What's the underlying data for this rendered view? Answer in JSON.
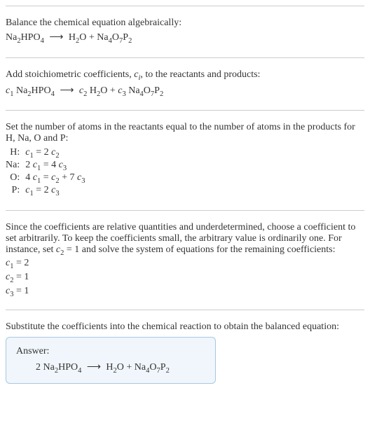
{
  "s1": {
    "title": "Balance the chemical equation algebraically:",
    "eq": "Na<sub>2</sub>HPO<sub>4</sub> <span class='arrow'>⟶</span> H<sub>2</sub>O + Na<sub>4</sub>O<sub>7</sub>P<sub>2</sub>"
  },
  "s2": {
    "title": "Add stoichiometric coefficients, <span class='italic'>c<sub>i</sub></span>, to the reactants and products:",
    "eq": "<span class='italic'>c</span><sub>1</sub> Na<sub>2</sub>HPO<sub>4</sub> <span class='arrow'>⟶</span> <span class='italic'>c</span><sub>2</sub> H<sub>2</sub>O + <span class='italic'>c</span><sub>3</sub> Na<sub>4</sub>O<sub>7</sub>P<sub>2</sub>"
  },
  "s3": {
    "title": "Set the number of atoms in the reactants equal to the number of atoms in the products for H, Na, O and P:",
    "rows": [
      {
        "label": "H:",
        "eq": "<span class='italic'>c</span><sub>1</sub> = 2 <span class='italic'>c</span><sub>2</sub>"
      },
      {
        "label": "Na:",
        "eq": "2 <span class='italic'>c</span><sub>1</sub> = 4 <span class='italic'>c</span><sub>3</sub>"
      },
      {
        "label": "O:",
        "eq": "4 <span class='italic'>c</span><sub>1</sub> = <span class='italic'>c</span><sub>2</sub> + 7 <span class='italic'>c</span><sub>3</sub>"
      },
      {
        "label": "P:",
        "eq": "<span class='italic'>c</span><sub>1</sub> = 2 <span class='italic'>c</span><sub>3</sub>"
      }
    ]
  },
  "s4": {
    "title": "Since the coefficients are relative quantities and underdetermined, choose a coefficient to set arbitrarily. To keep the coefficients small, the arbitrary value is ordinarily one. For instance, set <span class='italic'>c</span><sub>2</sub> = 1 and solve the system of equations for the remaining coefficients:",
    "rows": [
      {
        "eq": "<span class='italic'>c</span><sub>1</sub> = 2"
      },
      {
        "eq": "<span class='italic'>c</span><sub>2</sub> = 1"
      },
      {
        "eq": "<span class='italic'>c</span><sub>3</sub> = 1"
      }
    ]
  },
  "s5": {
    "title": "Substitute the coefficients into the chemical reaction to obtain the balanced equation:",
    "answer_label": "Answer:",
    "answer_eq": "2 Na<sub>2</sub>HPO<sub>4</sub> <span class='arrow'>⟶</span> H<sub>2</sub>O + Na<sub>4</sub>O<sub>7</sub>P<sub>2</sub>"
  }
}
